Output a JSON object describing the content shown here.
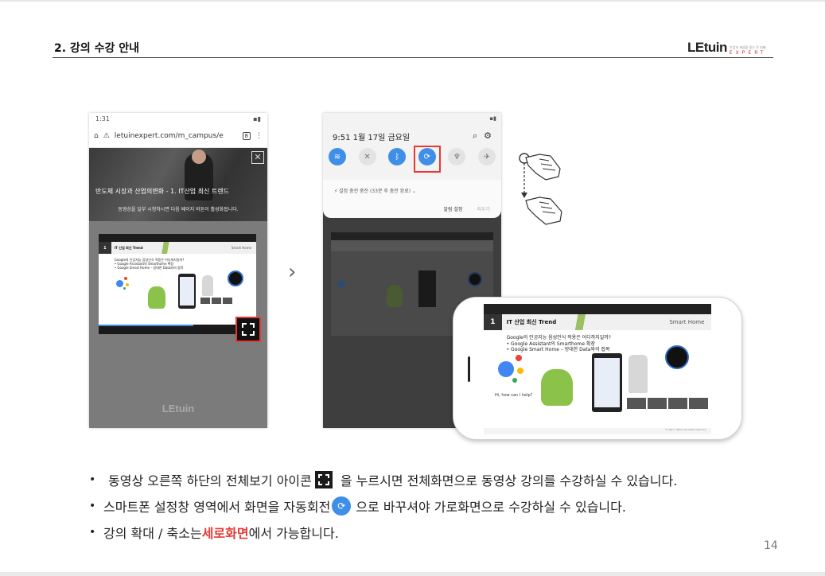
{
  "header": {
    "title": "2. 강의 수강 안내",
    "logo_main": "LEtuin",
    "logo_tag": "기업과 세상을 잇는 큰 지혜",
    "logo_sub": "EXPERT"
  },
  "phone1": {
    "time": "1:31",
    "url": "letuinexpert.com/m_campus/e",
    "tab_count": "8",
    "lecture_title": "반도체 시장과 산업의변화 - 1. IT산업 최신 트렌드",
    "notice": "동영상을 일부 시청하시면 다음 페이지 버튼이 활성화됩니다.",
    "close_glyph": "✕",
    "watermark": "LEtuin"
  },
  "mini_slide": {
    "num": "1",
    "title": "IT 산업 최신 Trend",
    "tag": "Smart Home",
    "line1": "Google의 인공지능 음성인식 적용은 어디까지일까?",
    "line2": "•  Google Assistant의 Smarthome 확장",
    "line3": "•  Google Smart Home – 방대한 Data와의 접목",
    "bubble": "Hi, how can I help?",
    "footer": "© 2017. LEtuin all rights reserved."
  },
  "phone2": {
    "datetime": "9:51  1월 17일 금요일",
    "notif_text": "⚡ 설정   충전 중전 (33분 후 충전 완료)  ⌄",
    "notif_action1": "알림 설정",
    "notif_action2": "지우기"
  },
  "bullets": {
    "b1_pre": "동영상 오른쪽 하단의 전체보기 아이콘",
    "b1_post": "을 누르시면 전체화면으로 동영상 강의를 수강하실 수 있습니다.",
    "b2_pre": "스마트폰 설정창 영역에서 화면을 자동회전",
    "b2_post": "으로 바꾸셔야 가로화면으로 수강하실 수 있습니다.",
    "b3_pre": "강의 확대 / 축소는 ",
    "b3_em": "세로화면",
    "b3_post": "에서 가능합니다."
  },
  "page_number": "14",
  "colors": {
    "highlight": "#e53935",
    "toggle_on": "#3f8ee8",
    "android": "#8bc34a"
  }
}
